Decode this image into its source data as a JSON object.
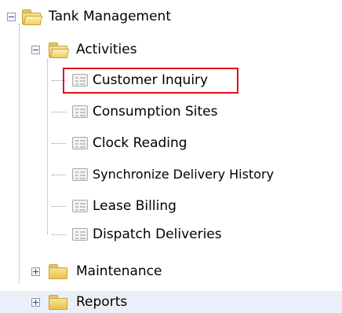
{
  "tree": {
    "root": {
      "label": "Tank Management",
      "expanded": true,
      "children": {
        "activities": {
          "label": "Activities",
          "expanded": true,
          "items": [
            {
              "label": "Customer Inquiry",
              "selected": true
            },
            {
              "label": "Consumption Sites"
            },
            {
              "label": "Clock Reading"
            },
            {
              "label": "Synchronize Delivery History"
            },
            {
              "label": "Lease Billing"
            },
            {
              "label": "Dispatch Deliveries"
            }
          ]
        },
        "maintenance": {
          "label": "Maintenance",
          "expanded": false
        },
        "reports": {
          "label": "Reports",
          "expanded": false,
          "hovered": true
        }
      }
    }
  },
  "colors": {
    "selection_border": "#e0101a",
    "hover_row": "#eaf0f8",
    "folder_yellow": "#e8c24e"
  }
}
